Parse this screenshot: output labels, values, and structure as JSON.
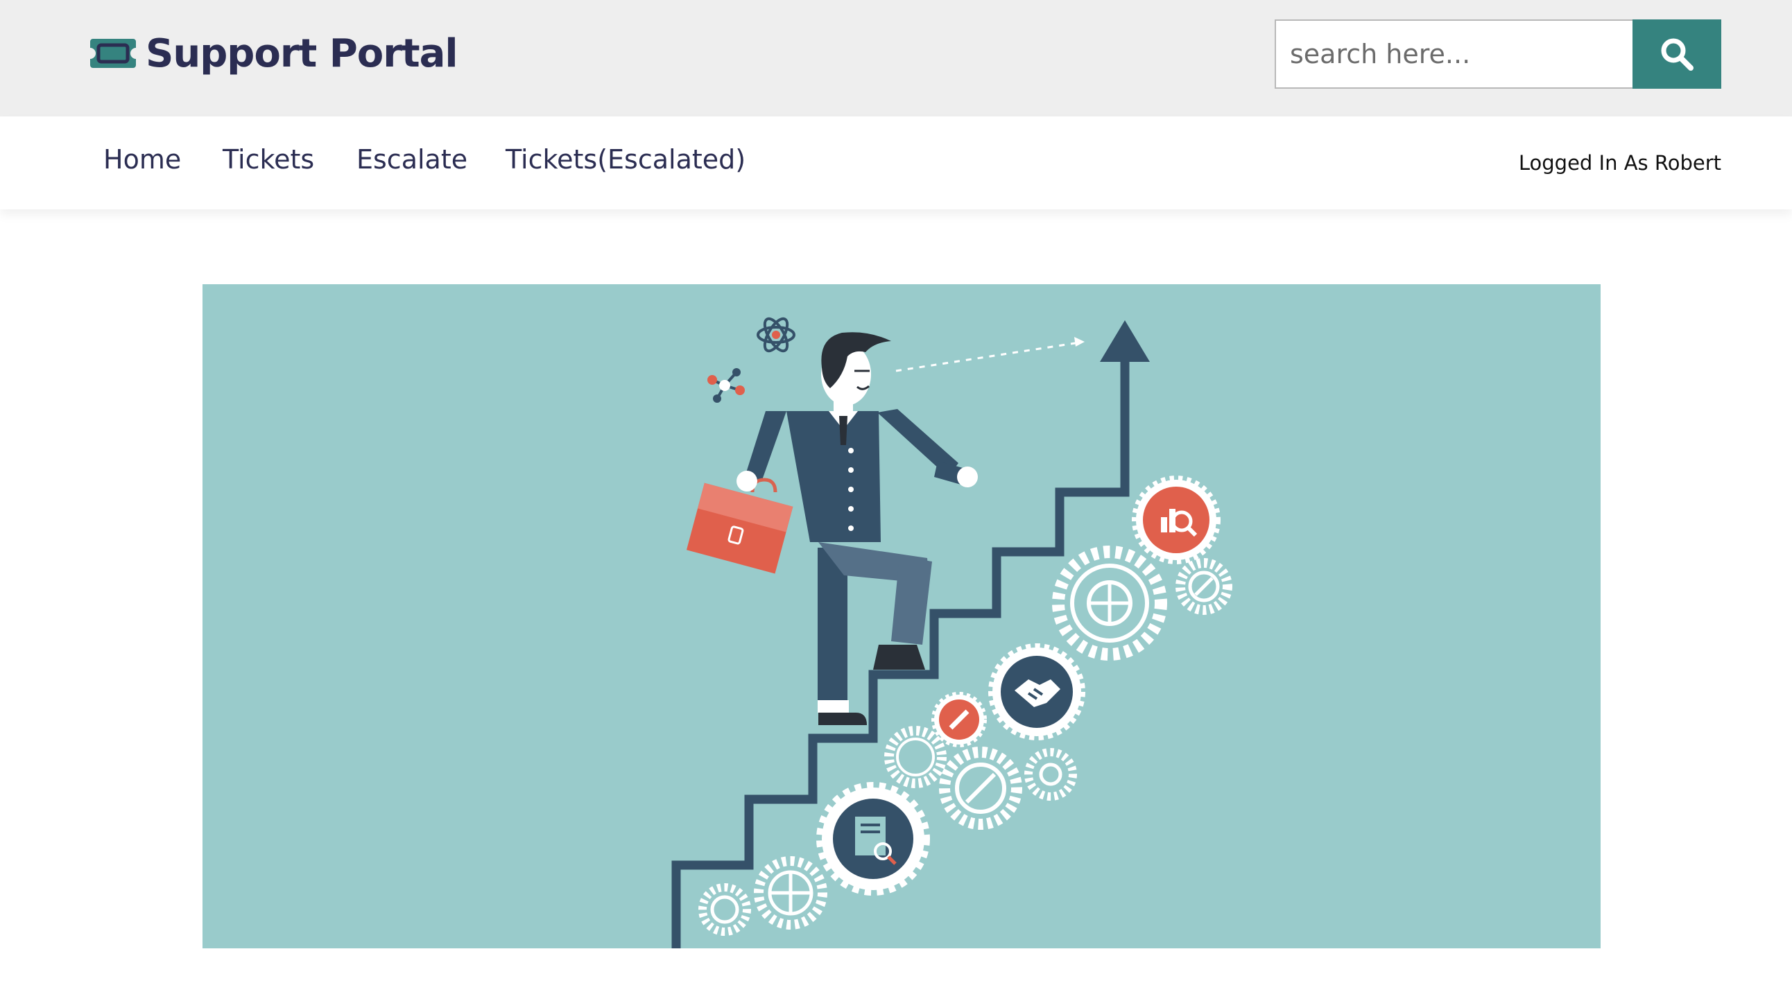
{
  "header": {
    "brand_title": "Support Portal",
    "brand_icon": "ticket-icon",
    "search_placeholder": "search here...",
    "search_icon": "search-icon"
  },
  "nav": {
    "items": [
      "Home",
      "Tickets",
      "Escalate",
      "Tickets(Escalated)"
    ],
    "user_status": "Logged In As Robert"
  },
  "hero": {
    "image": "businessman-climbing-stairs-illustration"
  },
  "colors": {
    "accent": "#35837f",
    "text": "#2b2d52",
    "topbar_bg": "#eeeeee",
    "hero_bg": "#99cbcb",
    "illustration_navy": "#355169",
    "illustration_red": "#e0604c"
  }
}
